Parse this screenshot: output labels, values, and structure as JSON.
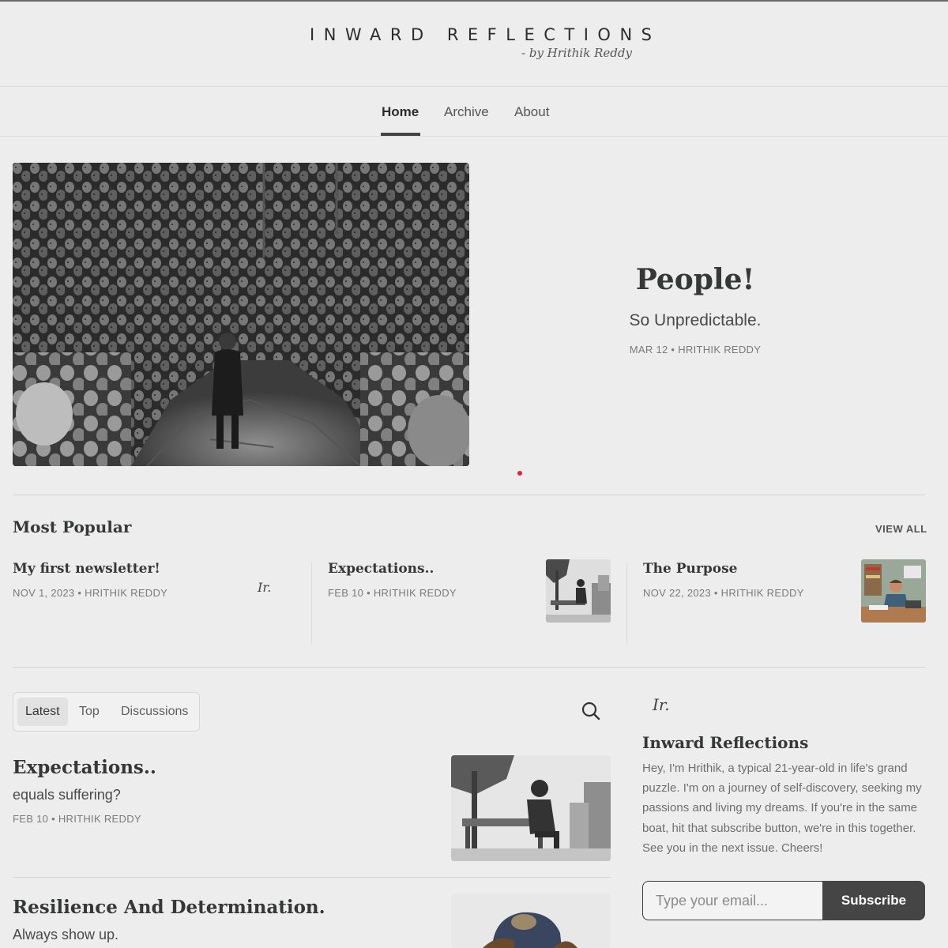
{
  "site": {
    "title": "INWARD REFLECTIONS",
    "byline": "- by Hrithik Reddy",
    "logo_mark": "Ir."
  },
  "nav": {
    "items": [
      {
        "label": "Home",
        "active": true
      },
      {
        "label": "Archive",
        "active": false
      },
      {
        "label": "About",
        "active": false
      }
    ]
  },
  "hero": {
    "title": "People!",
    "subtitle": "So Unpredictable.",
    "meta": "MAR 12 • HRITHIK REDDY",
    "image": "crowd-illustration"
  },
  "most_popular": {
    "heading": "Most Popular",
    "view_all": "VIEW ALL",
    "items": [
      {
        "title": "My first newsletter!",
        "meta": "NOV 1, 2023 • HRITHIK REDDY",
        "thumb": "logo-mark",
        "thumb_text": "Ir."
      },
      {
        "title": "Expectations..",
        "meta": "FEB 10 • HRITHIK REDDY",
        "thumb": "bench-man-illustration"
      },
      {
        "title": "The Purpose",
        "meta": "NOV 22, 2023 • HRITHIK REDDY",
        "thumb": "desk-man-illustration"
      }
    ]
  },
  "tabs": {
    "items": [
      {
        "label": "Latest",
        "active": true
      },
      {
        "label": "Top",
        "active": false
      },
      {
        "label": "Discussions",
        "active": false
      }
    ],
    "search_icon": "search-icon"
  },
  "posts": [
    {
      "title": "Expectations..",
      "subtitle": "equals suffering?",
      "meta": "FEB 10 • HRITHIK REDDY",
      "image": "bench-man-illustration"
    },
    {
      "title": "Resilience And Determination.",
      "subtitle": "Always show up.",
      "meta": "",
      "image": "cap-person-illustration"
    }
  ],
  "sidebar": {
    "logo_mark": "Ir.",
    "title": "Inward Reflections",
    "description": "Hey, I'm Hrithik, a typical 21-year-old in life's grand puzzle. I'm on a journey of self-discovery, seeking my passions and living my dreams. If you're in the same boat, hit that subscribe button, we're in this together. See you in the next issue. Cheers!",
    "email_placeholder": "Type your email...",
    "subscribe_label": "Subscribe"
  },
  "colors": {
    "background": "#ededed",
    "text": "#363737",
    "button": "#454545",
    "accent_dot": "#d9272e"
  }
}
